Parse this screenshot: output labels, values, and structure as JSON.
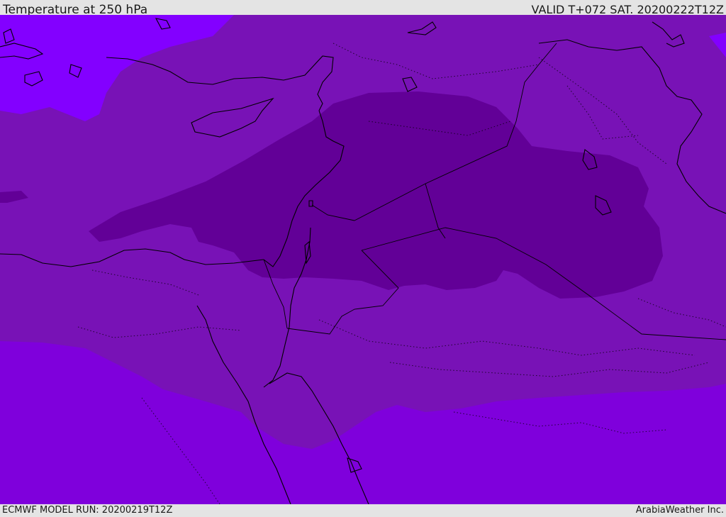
{
  "header": {
    "title": "Temperature at 250 hPa",
    "valid_time": "VALID T+072 SAT. 20200222T12Z"
  },
  "footer": {
    "model_run": "ECMWF MODEL RUN: 20200219T12Z",
    "credit": "ArabiaWeather Inc."
  },
  "map": {
    "parameter": "Temperature",
    "level": "250 hPa",
    "fill_colors": {
      "coldest": "#620097",
      "cold": "#7812b6",
      "mid": "#7f00dc",
      "warm_nw": "#8300ff"
    },
    "boundary_color": "#000000"
  }
}
